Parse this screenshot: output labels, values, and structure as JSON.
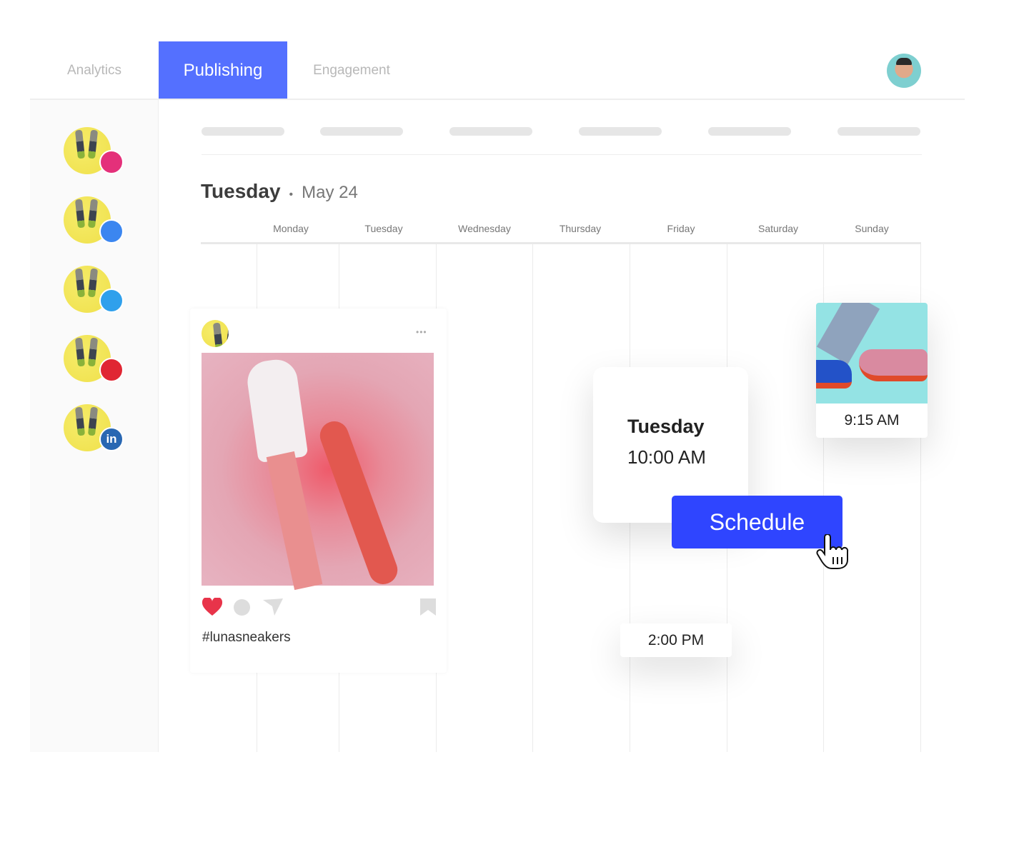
{
  "tabs": [
    {
      "label": "Analytics"
    },
    {
      "label": "Publishing",
      "active": true
    },
    {
      "label": "Engagement"
    }
  ],
  "accent": "#5470ff",
  "sidebar": {
    "accounts": [
      {
        "network": "instagram",
        "icon": "instagram-icon",
        "color": "#e4307a"
      },
      {
        "network": "facebook",
        "icon": "facebook-icon",
        "color": "#3b86f0"
      },
      {
        "network": "twitter",
        "icon": "twitter-icon",
        "color": "#2fa0ec"
      },
      {
        "network": "pinterest",
        "icon": "pinterest-icon",
        "color": "#e02633"
      },
      {
        "network": "linkedin",
        "icon": "linkedin-icon",
        "color": "#2867b2",
        "glyph": "in"
      }
    ]
  },
  "calendar": {
    "title_day": "Tuesday",
    "separator": "•",
    "title_date": "May 24",
    "days": [
      "Monday",
      "Tuesday",
      "Wednesday",
      "Thursday",
      "Friday",
      "Saturday",
      "Sunday"
    ]
  },
  "post": {
    "hashtag": "#lunasneakers",
    "more": "•••"
  },
  "schedule_card": {
    "day": "Tuesday",
    "time": "10:00 AM",
    "button": "Schedule",
    "button_color": "#2f45ff"
  },
  "scheduled": [
    {
      "time": "9:15 AM"
    },
    {
      "time": "2:00 PM"
    }
  ]
}
